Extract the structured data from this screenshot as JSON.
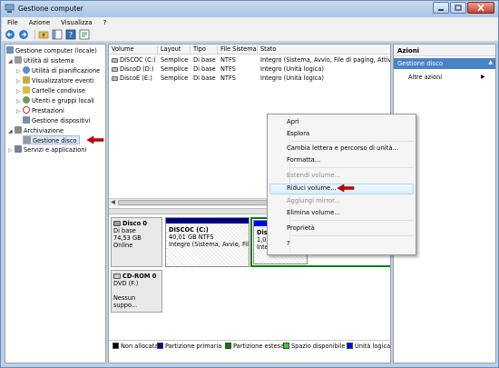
{
  "window": {
    "title": "Gestione computer"
  },
  "menu": [
    "File",
    "Azione",
    "Visualizza",
    "?"
  ],
  "tree": {
    "root": "Gestione computer (locale)",
    "system_tools": "Utilità di sistema",
    "items": [
      "Utilità di pianificazione",
      "Visualizzatore eventi",
      "Cartelle condivise",
      "Utenti e gruppi locali",
      "Prestazioni",
      "Gestione dispositivi"
    ],
    "storage": "Archiviazione",
    "disk_mgmt": "Gestione disco",
    "services": "Servizi e applicazioni"
  },
  "volume_table": {
    "headers": [
      "Volume",
      "Layout",
      "Tipo",
      "File Sistema",
      "Stato"
    ],
    "rows": [
      [
        "DISCOC (C:)",
        "Semplice",
        "Di base",
        "NTFS",
        "Integro (Sistema, Avvio, File di paging, Attivo,"
      ],
      [
        "DiscoD (D:)",
        "Semplice",
        "Di base",
        "NTFS",
        "Integro (Unità logica)"
      ],
      [
        "DiscoE (E:)",
        "Semplice",
        "Di base",
        "NTFS",
        "Integro (Unità logica)"
      ]
    ]
  },
  "disk0": {
    "name": "Disco 0",
    "type": "Di base",
    "size": "74,53 GB",
    "status": "Online",
    "p1": {
      "name": "DISCOC (C:)",
      "size": "40,01 GB NTFS",
      "status": "Integro (Sistema, Avvio, Fil"
    },
    "p2": {
      "name": "Disc",
      "size": "1,00",
      "status": "Inte"
    }
  },
  "cdrom0": {
    "name": "CD-ROM 0",
    "type": "DVD (F:)",
    "status": "Nessun suppo..."
  },
  "legend": [
    {
      "label": "Non allocata",
      "color": "#000000"
    },
    {
      "label": "Partizione primaria",
      "color": "#00007f"
    },
    {
      "label": "Partizione estesa",
      "color": "#008000"
    },
    {
      "label": "Spazio disponibile",
      "color": "#33cc33"
    },
    {
      "label": "Unità logica",
      "color": "#0000ff"
    }
  ],
  "actions": {
    "header": "Azioni",
    "section": "Gestione disco",
    "more": "Altre azioni"
  },
  "context_menu": {
    "apri": "Apri",
    "esplora": "Esplora",
    "cambia": "Cambia lettera e percorso di unità...",
    "formatta": "Formatta...",
    "estendi": "Estendi volume...",
    "riduci": "Riduci volume...",
    "aggiungi": "Aggiungi mirror...",
    "elimina": "Elimina volume...",
    "proprieta": "Proprietà",
    "help": "?"
  },
  "colors": {
    "accent": "#4a83c6",
    "highlight_arrow": "#cc0000"
  }
}
